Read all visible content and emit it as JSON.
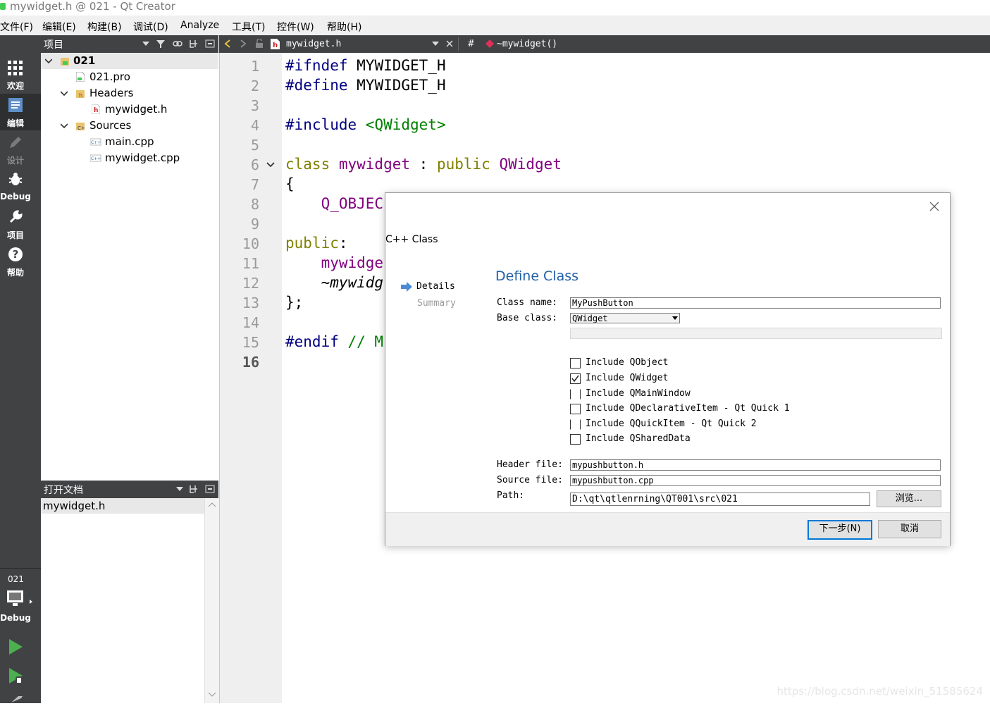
{
  "window": {
    "title": "mywidget.h @ 021 - Qt Creator"
  },
  "menu": [
    "文件(F)",
    "编辑(E)",
    "构建(B)",
    "调试(D)",
    "Analyze",
    "工具(T)",
    "控件(W)",
    "帮助(H)"
  ],
  "modes": [
    {
      "label": "欢迎",
      "icon": "grid-icon"
    },
    {
      "label": "编辑",
      "icon": "edit-doc-icon",
      "selected": true
    },
    {
      "label": "设计",
      "icon": "pencil-icon",
      "disabled": true
    },
    {
      "label": "Debug",
      "icon": "bug-icon"
    },
    {
      "label": "项目",
      "icon": "wrench-icon"
    },
    {
      "label": "帮助",
      "icon": "help-icon"
    }
  ],
  "kit": {
    "project": "021",
    "label": "Debug"
  },
  "project_panel": {
    "title": "项目",
    "tree": [
      {
        "label": "021",
        "bold": true,
        "expanded": true
      },
      {
        "label": "021.pro"
      },
      {
        "label": "Headers",
        "expanded": true
      },
      {
        "label": "mywidget.h"
      },
      {
        "label": "Sources",
        "expanded": true
      },
      {
        "label": "main.cpp"
      },
      {
        "label": "mywidget.cpp"
      }
    ]
  },
  "open_docs": {
    "title": "打开文档",
    "items": [
      "mywidget.h"
    ]
  },
  "editor": {
    "file": "mywidget.h",
    "hash": "#",
    "symbol": "~mywidget()",
    "lines": [
      "1",
      "2",
      "3",
      "4",
      "5",
      "6",
      "7",
      "8",
      "9",
      "10",
      "11",
      "12",
      "13",
      "14",
      "15",
      "16"
    ],
    "code": {
      "l1a": "#ifndef",
      "l1b": " MYWIDGET_H",
      "l2a": "#define",
      "l2b": " MYWIDGET_H",
      "l4a": "#include",
      "l4b": " <QWidget>",
      "l6a": "class",
      "l6b": " mywidget",
      "l6c": " : ",
      "l6d": "public",
      "l6e": " QWidget",
      "l7": "{",
      "l8": "    Q_OBJEC",
      "l10a": "public",
      "l10b": ":",
      "l11": "    mywidge",
      "l12": "    ~mywidg",
      "l13": "};",
      "l15a": "#endif",
      "l15b": " // M"
    }
  },
  "dialog": {
    "window_title": "C++ Class",
    "steps": [
      "Details",
      "Summary"
    ],
    "heading": "Define Class",
    "class_name_label": "Class name:",
    "class_name": "MyPushButton",
    "base_class_label": "Base class:",
    "base_class": "QWidget",
    "checkboxes": [
      {
        "label": "Include QObject",
        "checked": false
      },
      {
        "label": "Include QWidget",
        "checked": true
      },
      {
        "label": "Include QMainWindow",
        "checked": false
      },
      {
        "label": "Include QDeclarativeItem - Qt Quick 1",
        "checked": false
      },
      {
        "label": "Include QQuickItem - Qt Quick 2",
        "checked": false
      },
      {
        "label": "Include QSharedData",
        "checked": false
      }
    ],
    "header_file_label": "Header file:",
    "header_file": "mypushbutton.h",
    "source_file_label": "Source file:",
    "source_file": "mypushbutton.cpp",
    "path_label": "Path:",
    "path": "D:\\qt\\qtlenrning\\QT001\\src\\021",
    "browse": "浏览...",
    "next": "下一步(N)",
    "cancel": "取消"
  },
  "watermark": "https://blog.csdn.net/weixin_51585624"
}
